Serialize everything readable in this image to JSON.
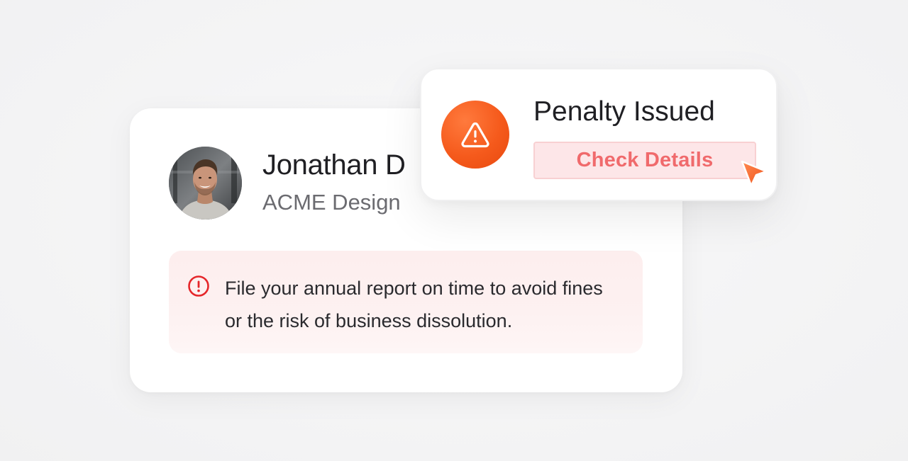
{
  "profile": {
    "name": "Jonathan D",
    "company": "ACME Design",
    "avatar_icon": "user-photo"
  },
  "notice": {
    "icon": "exclamation-circle-icon",
    "message": "File your annual report on time to avoid fines or the risk of business dissolution."
  },
  "penalty": {
    "icon": "warning-triangle-icon",
    "title": "Penalty Issued",
    "button_label": "Check Details"
  },
  "colors": {
    "accent_orange": "#f55a1c",
    "button_text": "#f06a6c",
    "button_bg": "#fde6e8",
    "alert_red": "#e5262a",
    "notice_bg": "#fdeeee"
  }
}
